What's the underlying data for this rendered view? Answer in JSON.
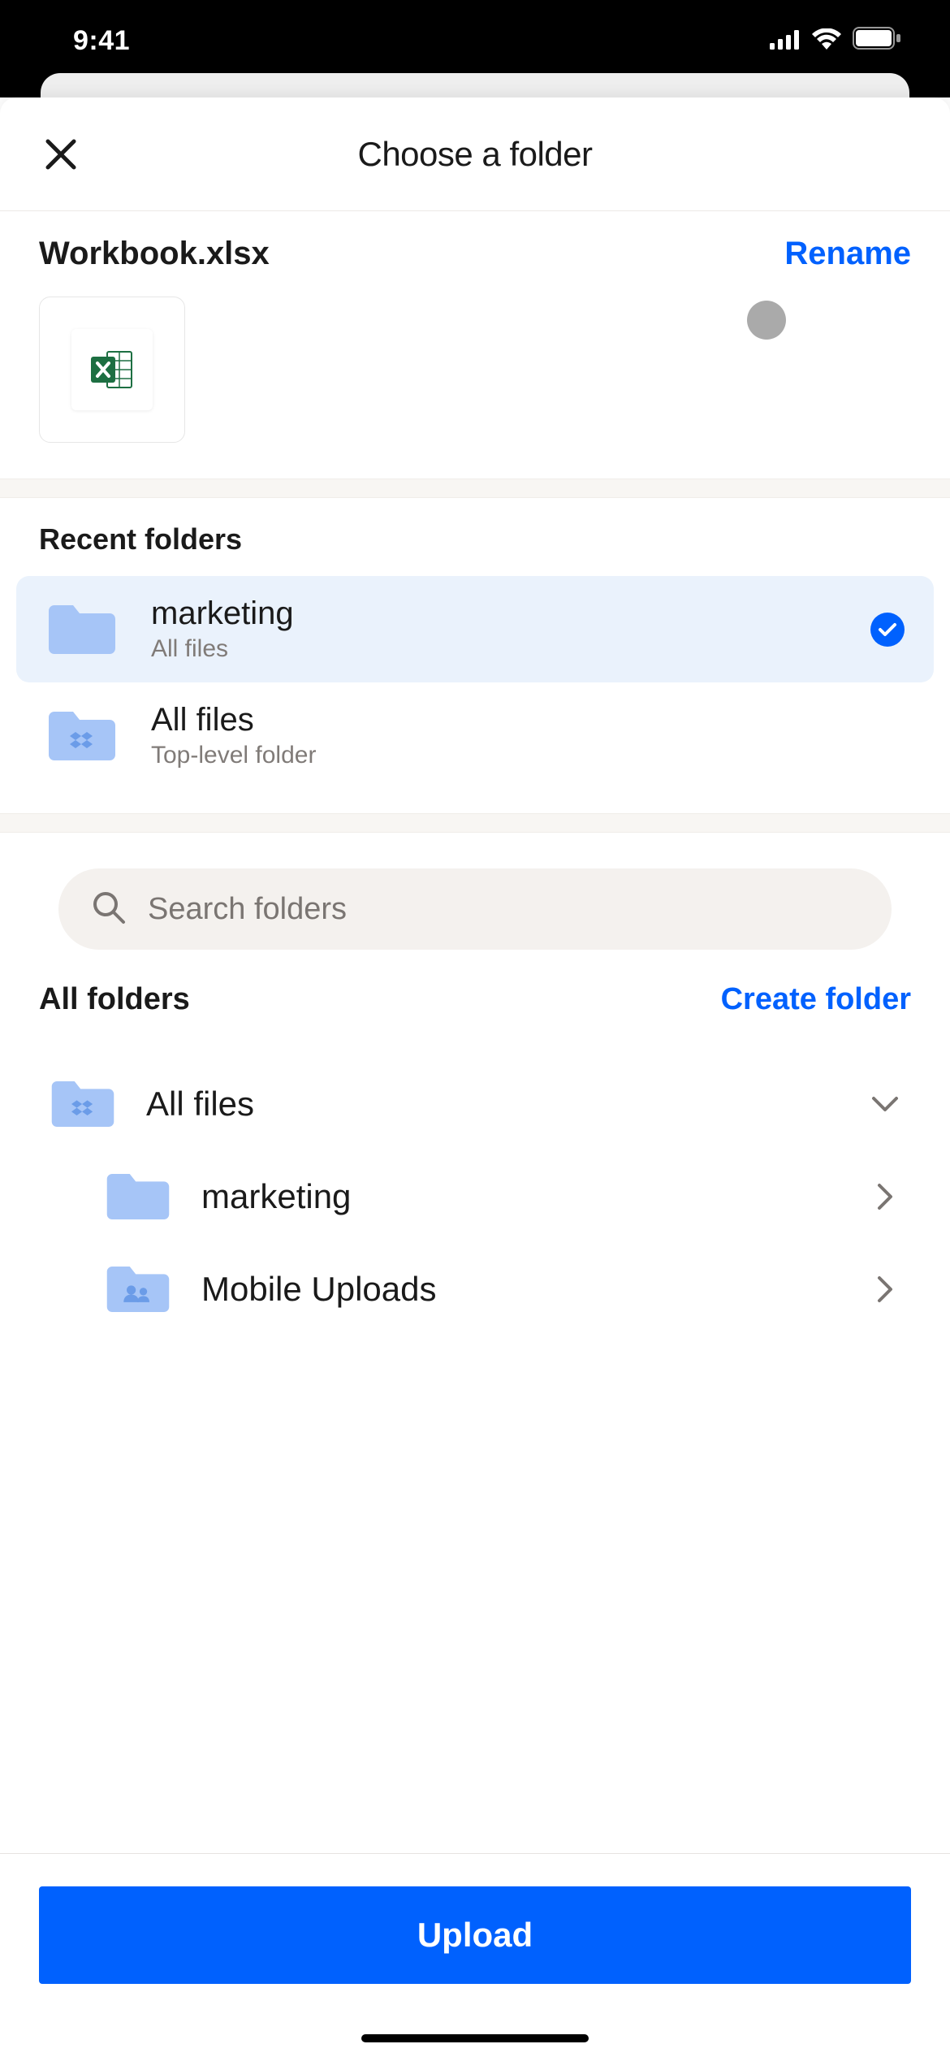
{
  "status": {
    "time": "9:41"
  },
  "sheet": {
    "title": "Choose a folder"
  },
  "file": {
    "name": "Workbook.xlsx",
    "rename_label": "Rename"
  },
  "recent": {
    "header": "Recent folders",
    "items": [
      {
        "name": "marketing",
        "subtitle": "All files",
        "selected": true,
        "icon": "folder"
      },
      {
        "name": "All files",
        "subtitle": "Top-level folder",
        "selected": false,
        "icon": "dropbox-folder"
      }
    ]
  },
  "search": {
    "placeholder": "Search folders"
  },
  "all_folders": {
    "title": "All folders",
    "create_label": "Create folder"
  },
  "tree": [
    {
      "name": "All files",
      "icon": "dropbox-folder",
      "expand": "down",
      "level": 0
    },
    {
      "name": "marketing",
      "icon": "folder",
      "expand": "right",
      "level": 1
    },
    {
      "name": "Mobile Uploads",
      "icon": "shared-folder",
      "expand": "right",
      "level": 1
    }
  ],
  "footer": {
    "upload_label": "Upload"
  },
  "colors": {
    "accent": "#0061fe",
    "folder": "#a6c5f7"
  }
}
